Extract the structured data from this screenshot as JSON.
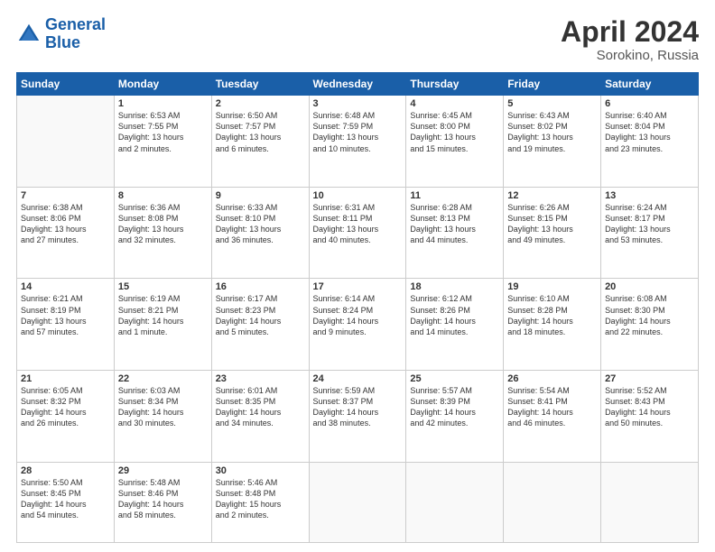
{
  "logo": {
    "text_general": "General",
    "text_blue": "Blue"
  },
  "title": "April 2024",
  "subtitle": "Sorokino, Russia",
  "weekdays": [
    "Sunday",
    "Monday",
    "Tuesday",
    "Wednesday",
    "Thursday",
    "Friday",
    "Saturday"
  ],
  "weeks": [
    [
      {
        "day": "",
        "info": ""
      },
      {
        "day": "1",
        "info": "Sunrise: 6:53 AM\nSunset: 7:55 PM\nDaylight: 13 hours\nand 2 minutes."
      },
      {
        "day": "2",
        "info": "Sunrise: 6:50 AM\nSunset: 7:57 PM\nDaylight: 13 hours\nand 6 minutes."
      },
      {
        "day": "3",
        "info": "Sunrise: 6:48 AM\nSunset: 7:59 PM\nDaylight: 13 hours\nand 10 minutes."
      },
      {
        "day": "4",
        "info": "Sunrise: 6:45 AM\nSunset: 8:00 PM\nDaylight: 13 hours\nand 15 minutes."
      },
      {
        "day": "5",
        "info": "Sunrise: 6:43 AM\nSunset: 8:02 PM\nDaylight: 13 hours\nand 19 minutes."
      },
      {
        "day": "6",
        "info": "Sunrise: 6:40 AM\nSunset: 8:04 PM\nDaylight: 13 hours\nand 23 minutes."
      }
    ],
    [
      {
        "day": "7",
        "info": "Sunrise: 6:38 AM\nSunset: 8:06 PM\nDaylight: 13 hours\nand 27 minutes."
      },
      {
        "day": "8",
        "info": "Sunrise: 6:36 AM\nSunset: 8:08 PM\nDaylight: 13 hours\nand 32 minutes."
      },
      {
        "day": "9",
        "info": "Sunrise: 6:33 AM\nSunset: 8:10 PM\nDaylight: 13 hours\nand 36 minutes."
      },
      {
        "day": "10",
        "info": "Sunrise: 6:31 AM\nSunset: 8:11 PM\nDaylight: 13 hours\nand 40 minutes."
      },
      {
        "day": "11",
        "info": "Sunrise: 6:28 AM\nSunset: 8:13 PM\nDaylight: 13 hours\nand 44 minutes."
      },
      {
        "day": "12",
        "info": "Sunrise: 6:26 AM\nSunset: 8:15 PM\nDaylight: 13 hours\nand 49 minutes."
      },
      {
        "day": "13",
        "info": "Sunrise: 6:24 AM\nSunset: 8:17 PM\nDaylight: 13 hours\nand 53 minutes."
      }
    ],
    [
      {
        "day": "14",
        "info": "Sunrise: 6:21 AM\nSunset: 8:19 PM\nDaylight: 13 hours\nand 57 minutes."
      },
      {
        "day": "15",
        "info": "Sunrise: 6:19 AM\nSunset: 8:21 PM\nDaylight: 14 hours\nand 1 minute."
      },
      {
        "day": "16",
        "info": "Sunrise: 6:17 AM\nSunset: 8:23 PM\nDaylight: 14 hours\nand 5 minutes."
      },
      {
        "day": "17",
        "info": "Sunrise: 6:14 AM\nSunset: 8:24 PM\nDaylight: 14 hours\nand 9 minutes."
      },
      {
        "day": "18",
        "info": "Sunrise: 6:12 AM\nSunset: 8:26 PM\nDaylight: 14 hours\nand 14 minutes."
      },
      {
        "day": "19",
        "info": "Sunrise: 6:10 AM\nSunset: 8:28 PM\nDaylight: 14 hours\nand 18 minutes."
      },
      {
        "day": "20",
        "info": "Sunrise: 6:08 AM\nSunset: 8:30 PM\nDaylight: 14 hours\nand 22 minutes."
      }
    ],
    [
      {
        "day": "21",
        "info": "Sunrise: 6:05 AM\nSunset: 8:32 PM\nDaylight: 14 hours\nand 26 minutes."
      },
      {
        "day": "22",
        "info": "Sunrise: 6:03 AM\nSunset: 8:34 PM\nDaylight: 14 hours\nand 30 minutes."
      },
      {
        "day": "23",
        "info": "Sunrise: 6:01 AM\nSunset: 8:35 PM\nDaylight: 14 hours\nand 34 minutes."
      },
      {
        "day": "24",
        "info": "Sunrise: 5:59 AM\nSunset: 8:37 PM\nDaylight: 14 hours\nand 38 minutes."
      },
      {
        "day": "25",
        "info": "Sunrise: 5:57 AM\nSunset: 8:39 PM\nDaylight: 14 hours\nand 42 minutes."
      },
      {
        "day": "26",
        "info": "Sunrise: 5:54 AM\nSunset: 8:41 PM\nDaylight: 14 hours\nand 46 minutes."
      },
      {
        "day": "27",
        "info": "Sunrise: 5:52 AM\nSunset: 8:43 PM\nDaylight: 14 hours\nand 50 minutes."
      }
    ],
    [
      {
        "day": "28",
        "info": "Sunrise: 5:50 AM\nSunset: 8:45 PM\nDaylight: 14 hours\nand 54 minutes."
      },
      {
        "day": "29",
        "info": "Sunrise: 5:48 AM\nSunset: 8:46 PM\nDaylight: 14 hours\nand 58 minutes."
      },
      {
        "day": "30",
        "info": "Sunrise: 5:46 AM\nSunset: 8:48 PM\nDaylight: 15 hours\nand 2 minutes."
      },
      {
        "day": "",
        "info": ""
      },
      {
        "day": "",
        "info": ""
      },
      {
        "day": "",
        "info": ""
      },
      {
        "day": "",
        "info": ""
      }
    ]
  ]
}
